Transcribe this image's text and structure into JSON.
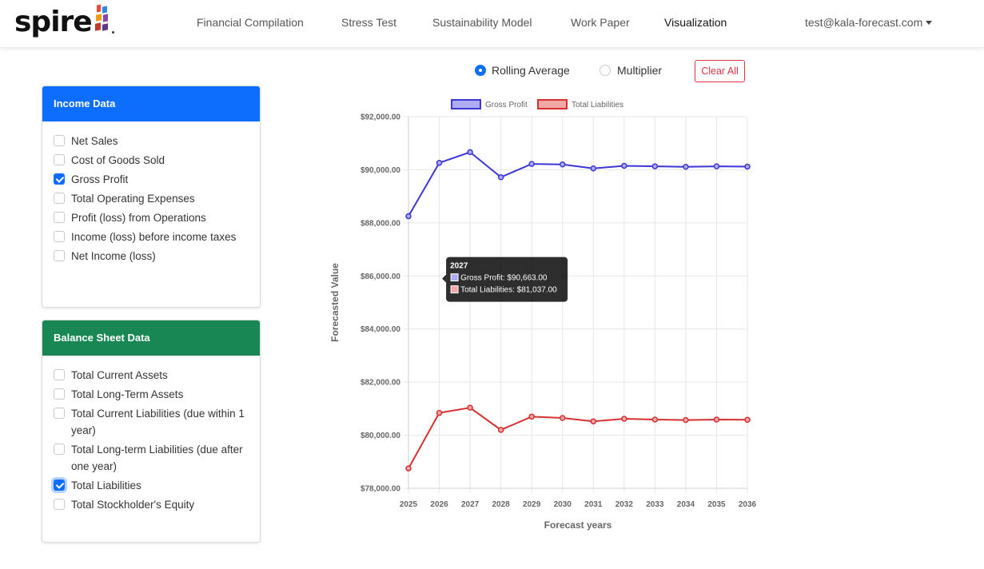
{
  "brand": {
    "name": "spire"
  },
  "nav": {
    "links": [
      "Financial Compilation",
      "Stress Test",
      "Sustainability Model",
      "Work Paper",
      "Visualization"
    ],
    "active": "Visualization",
    "user": "test@kala-forecast.com"
  },
  "income": {
    "title": "Income Data",
    "header_color": "#0d6efd",
    "items": [
      {
        "label": "Net Sales",
        "checked": false
      },
      {
        "label": "Cost of Goods Sold",
        "checked": false
      },
      {
        "label": "Gross Profit",
        "checked": true
      },
      {
        "label": "Total Operating Expenses",
        "checked": false
      },
      {
        "label": "Profit (loss) from Operations",
        "checked": false
      },
      {
        "label": "Income (loss) before income taxes",
        "checked": false
      },
      {
        "label": "Net Income (loss)",
        "checked": false
      }
    ]
  },
  "balance": {
    "title": "Balance Sheet Data",
    "header_color": "#198754",
    "items": [
      {
        "label": "Total Current Assets",
        "checked": false
      },
      {
        "label": "Total Long-Term Assets",
        "checked": false
      },
      {
        "label": "Total Current Liabilities (due within 1 year)",
        "checked": false
      },
      {
        "label": "Total Long-term Liabilities (due after one year)",
        "checked": false
      },
      {
        "label": "Total Liabilities",
        "checked": true
      },
      {
        "label": "Total Stockholder's Equity",
        "checked": false
      }
    ]
  },
  "mode": {
    "rolling_label": "Rolling Average",
    "multiplier_label": "Multiplier",
    "selected": "Rolling Average",
    "clear_label": "Clear All"
  },
  "chart_data": {
    "type": "line",
    "title": "",
    "xlabel": "Forecast years",
    "ylabel": "Forecasted Value",
    "categories": [
      "2025",
      "2026",
      "2027",
      "2028",
      "2029",
      "2030",
      "2031",
      "2032",
      "2033",
      "2034",
      "2035",
      "2036"
    ],
    "ylim": [
      78000,
      92000
    ],
    "y_ticks": [
      "$78,000.00",
      "$80,000.00",
      "$82,000.00",
      "$84,000.00",
      "$86,000.00",
      "$88,000.00",
      "$90,000.00",
      "$92,000.00"
    ],
    "grid": true,
    "legend_position": "top",
    "series": [
      {
        "name": "Gross Profit",
        "color": "#3b36d4",
        "fill": "#aeacf2",
        "values": [
          88250,
          90260,
          90663,
          89720,
          90220,
          90200,
          90050,
          90150,
          90130,
          90110,
          90130,
          90120
        ]
      },
      {
        "name": "Total Liabilities",
        "color": "#d62f2f",
        "fill": "#f2a7a7",
        "values": [
          78750,
          80840,
          81037,
          80200,
          80700,
          80650,
          80520,
          80620,
          80590,
          80570,
          80590,
          80580
        ]
      }
    ],
    "tooltip": {
      "title": "2027",
      "lines": [
        "Gross Profit: $90,663.00",
        "Total Liabilities: $81,037.00"
      ]
    }
  }
}
